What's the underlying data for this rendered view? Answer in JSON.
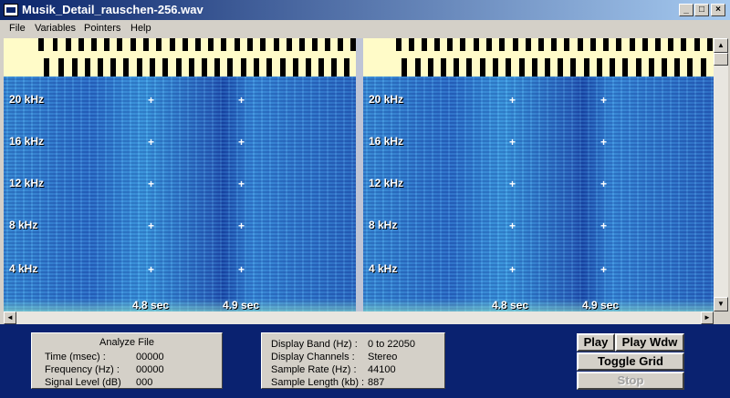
{
  "window": {
    "title": "Musik_Detail_rauschen-256.wav",
    "minimize_glyph": "_",
    "maximize_glyph": "□",
    "close_glyph": "×"
  },
  "menu": [
    "File",
    "Variables",
    "Pointers",
    "Help"
  ],
  "spectrogram": {
    "freq_labels": [
      "20 kHz",
      "16 kHz",
      "12 kHz",
      "8  kHz",
      "4  kHz"
    ],
    "time_labels": [
      "4.8 sec",
      "4.9 sec"
    ],
    "colors": {
      "strip": "#fffbc8",
      "background": "#2f6fc8"
    }
  },
  "analyze": {
    "header": "Analyze File",
    "rows": [
      {
        "label": "Time (msec) :",
        "value": "00000"
      },
      {
        "label": "Frequency (Hz) :",
        "value": "00000"
      },
      {
        "label": "Signal Level (dB)",
        "value": "000"
      }
    ]
  },
  "display": {
    "rows": [
      {
        "label": "Display Band (Hz) :",
        "value": "0 to 22050"
      },
      {
        "label": "Display Channels :",
        "value": "Stereo"
      },
      {
        "label": "Sample Rate (Hz) :",
        "value": "44100"
      },
      {
        "label": "Sample Length (kb) :",
        "value": "887"
      }
    ]
  },
  "controls": {
    "play": "Play",
    "play_wdw": "Play Wdw",
    "toggle_grid": "Toggle Grid",
    "stop": "Stop"
  }
}
